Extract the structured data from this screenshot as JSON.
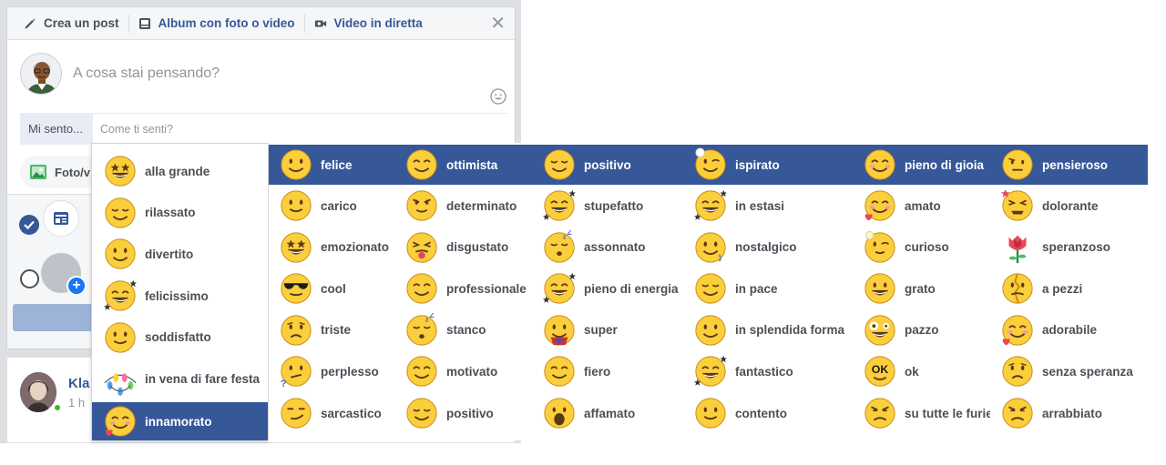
{
  "composer": {
    "tabs": [
      {
        "label": "Crea un post",
        "icon": "pencil-icon"
      },
      {
        "label": "Album con foto o video",
        "icon": "album-icon"
      },
      {
        "label": "Video in diretta",
        "icon": "video-camera-icon"
      }
    ],
    "close_icon": "close-icon",
    "placeholder": "A cosa stai pensando?",
    "feeling_label": "Mi sento...",
    "feeling_placeholder": "Come ti senti?",
    "foto_label": "Foto/v"
  },
  "feed": {
    "name": "Kla",
    "time": "1 h"
  },
  "feelings": {
    "first_column": [
      {
        "label": "alla grande",
        "emoji": "star-eyes"
      },
      {
        "label": "rilassato",
        "emoji": "relieved"
      },
      {
        "label": "divertito",
        "emoji": "happy"
      },
      {
        "label": "felicissimo",
        "emoji": "grin-stars"
      },
      {
        "label": "soddisfatto",
        "emoji": "smile"
      },
      {
        "label": "in vena di fare festa",
        "emoji": "party-lights"
      },
      {
        "label": "innamorato",
        "emoji": "love",
        "selected": true
      }
    ],
    "columns": [
      [
        {
          "label": "felice",
          "emoji": "happy"
        },
        {
          "label": "carico",
          "emoji": "smile"
        },
        {
          "label": "emozionato",
          "emoji": "star-eyes"
        },
        {
          "label": "cool",
          "emoji": "sunglasses"
        },
        {
          "label": "triste",
          "emoji": "sad"
        },
        {
          "label": "perplesso",
          "emoji": "confused"
        },
        {
          "label": "sarcastico",
          "emoji": "smirk"
        }
      ],
      [
        {
          "label": "ottimista",
          "emoji": "happy-closed"
        },
        {
          "label": "determinato",
          "emoji": "determined"
        },
        {
          "label": "disgustato",
          "emoji": "disgusted"
        },
        {
          "label": "professionale",
          "emoji": "happy-closed"
        },
        {
          "label": "stanco",
          "emoji": "sleepy"
        },
        {
          "label": "motivato",
          "emoji": "happy-closed"
        },
        {
          "label": "positivo",
          "emoji": "relieved"
        }
      ],
      [
        {
          "label": "positivo",
          "emoji": "relieved"
        },
        {
          "label": "stupefatto",
          "emoji": "grin-stars"
        },
        {
          "label": "assonnato",
          "emoji": "sleepy"
        },
        {
          "label": "pieno di energia",
          "emoji": "grin-stars"
        },
        {
          "label": "super",
          "emoji": "super"
        },
        {
          "label": "fiero",
          "emoji": "happy-closed"
        },
        {
          "label": "affamato",
          "emoji": "shocked"
        }
      ],
      [
        {
          "label": "ispirato",
          "emoji": "wink"
        },
        {
          "label": "in estasi",
          "emoji": "grin-stars"
        },
        {
          "label": "nostalgico",
          "emoji": "nostalgic"
        },
        {
          "label": "in pace",
          "emoji": "relieved"
        },
        {
          "label": "in splendida forma",
          "emoji": "happy"
        },
        {
          "label": "fantastico",
          "emoji": "grin-stars"
        },
        {
          "label": "contento",
          "emoji": "smile"
        }
      ],
      [
        {
          "label": "pieno di gioia",
          "emoji": "joy"
        },
        {
          "label": "amato",
          "emoji": "love"
        },
        {
          "label": "curioso",
          "emoji": "curious"
        },
        {
          "label": "grato",
          "emoji": "grin"
        },
        {
          "label": "pazzo",
          "emoji": "crazy"
        },
        {
          "label": "ok",
          "emoji": "ok"
        },
        {
          "label": "su tutte le furie",
          "emoji": "angry"
        }
      ],
      [
        {
          "label": "pensieroso",
          "emoji": "thinking"
        },
        {
          "label": "dolorante",
          "emoji": "pain"
        },
        {
          "label": "speranzoso",
          "emoji": "rose"
        },
        {
          "label": "a pezzi",
          "emoji": "broken"
        },
        {
          "label": "adorabile",
          "emoji": "love"
        },
        {
          "label": "senza speranza",
          "emoji": "sad"
        },
        {
          "label": "arrabbiato",
          "emoji": "angry"
        }
      ]
    ]
  },
  "colors": {
    "brand": "#365899",
    "emoji_yellow": "#fbce3c",
    "emoji_outline": "#c98a12"
  }
}
